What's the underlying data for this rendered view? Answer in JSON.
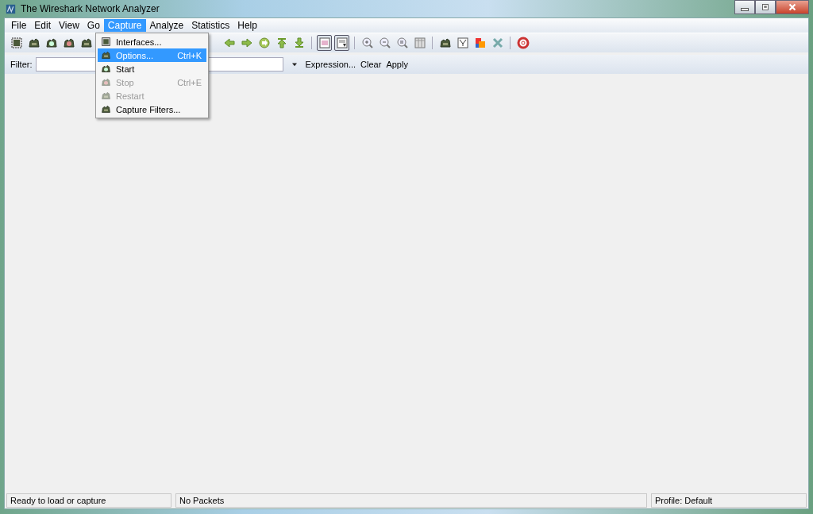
{
  "window": {
    "title": "The Wireshark Network Analyzer"
  },
  "menu": [
    {
      "label": "File",
      "selected": false
    },
    {
      "label": "Edit",
      "selected": false
    },
    {
      "label": "View",
      "selected": false
    },
    {
      "label": "Go",
      "selected": false
    },
    {
      "label": "Capture",
      "selected": true
    },
    {
      "label": "Analyze",
      "selected": false
    },
    {
      "label": "Statistics",
      "selected": false
    },
    {
      "label": "Help",
      "selected": false
    }
  ],
  "capture_menu": [
    {
      "label": "Interfaces...",
      "disabled": false,
      "selected": false
    },
    {
      "label": "Options...",
      "shortcut": "Ctrl+K",
      "disabled": false,
      "selected": true
    },
    {
      "label": "Start",
      "disabled": false,
      "selected": false
    },
    {
      "label": "Stop",
      "shortcut": "Ctrl+E",
      "disabled": true,
      "selected": false
    },
    {
      "label": "Restart",
      "disabled": true,
      "selected": false
    },
    {
      "label": "Capture Filters...",
      "disabled": false,
      "selected": false
    }
  ],
  "toolbar_toggles": [
    {
      "on": true
    },
    {
      "on": true
    }
  ],
  "filter": {
    "label": "Filter:",
    "links": [
      "Expression...",
      "Clear",
      "Apply"
    ]
  },
  "status_bar": [
    "Ready to load or capture",
    "No Packets",
    "Profile: Default"
  ]
}
